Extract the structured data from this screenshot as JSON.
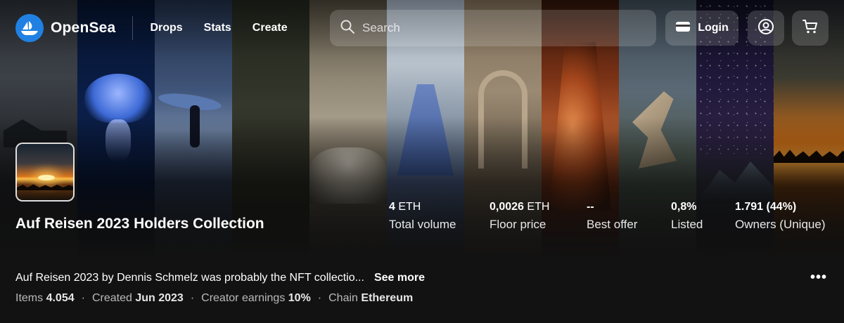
{
  "nav": {
    "brand": "OpenSea",
    "links": [
      "Drops",
      "Stats",
      "Create"
    ],
    "search_placeholder": "Search",
    "login_label": "Login"
  },
  "collection": {
    "title": "Auf Reisen 2023 Holders Collection",
    "description": "Auf Reisen 2023 by Dennis Schmelz was probably the NFT collectio...",
    "see_more": "See more",
    "more_menu": "•••"
  },
  "stats": [
    {
      "value": "4",
      "unit": "ETH",
      "label": "Total volume"
    },
    {
      "value": "0,0026",
      "unit": "ETH",
      "label": "Floor price"
    },
    {
      "value": "--",
      "unit": "",
      "label": "Best offer"
    },
    {
      "value": "0,8%",
      "unit": "",
      "label": "Listed"
    },
    {
      "value": "1.791 (44%)",
      "unit": "",
      "label": "Owners (Unique)"
    }
  ],
  "meta": {
    "items_label": "Items",
    "items_value": "4.054",
    "created_label": "Created",
    "created_value": "Jun 2023",
    "earnings_label": "Creator earnings",
    "earnings_value": "10%",
    "chain_label": "Chain",
    "chain_value": "Ethereum"
  },
  "icons": {
    "logo": "opensea-boat-icon",
    "search": "search-icon",
    "wallet": "wallet-icon",
    "account": "account-circle-icon",
    "cart": "cart-icon"
  },
  "colors": {
    "brand_blue": "#2081e2",
    "background": "#121212"
  }
}
